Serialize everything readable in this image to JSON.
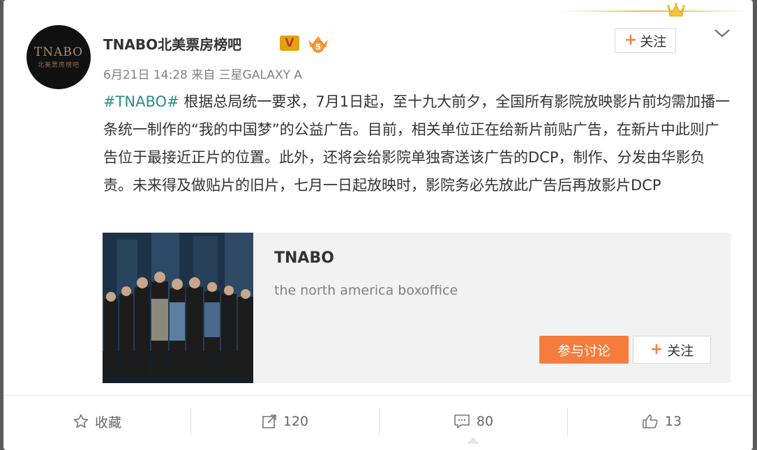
{
  "user": {
    "name": "TNABO北美票房榜吧",
    "avatar_text": "TNABO",
    "avatar_subtext": "北美票房榜吧",
    "verified_badge": "V",
    "vip_badge": "vip-crown-icon"
  },
  "post": {
    "date": "6月21日 14:28",
    "source_prefix": "来自",
    "source": "三星GALAXY A",
    "hashtag": "#TNABO#",
    "text": " 根据总局统一要求，7月1日起，至十九大前夕，全国所有影院放映影片前均需加播一条统一制作的“我的中国梦”的公益广告。目前，相关单位正在给新片前贴广告，在新片中此则广告位于最接近正片的位置。此外，还将会给影院单独寄送该广告的DCP，制作、分发由华影负责。未来得及做贴片的旧片，七月一日起放映时，影院务必先放此广告后再放影片DCP"
  },
  "header": {
    "follow_label": "关注"
  },
  "share_card": {
    "title": "TNABO",
    "description": "the north america boxoffice",
    "join_label": "参与讨论",
    "follow_label": "关注"
  },
  "actions": {
    "favorite_label": "收藏",
    "repost_count": "120",
    "comment_count": "80",
    "like_count": "13"
  },
  "colors": {
    "accent_orange": "#f57c3d",
    "hashtag_teal": "#2f8a8a",
    "plus_orange": "#ff8140"
  }
}
